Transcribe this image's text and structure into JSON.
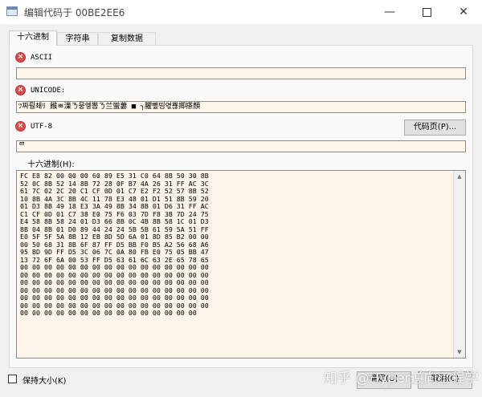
{
  "window": {
    "title": "编辑代码于 00BE2EE6",
    "minimize": "—",
    "close": "✕"
  },
  "tabs": [
    {
      "label": "十六进制"
    },
    {
      "label": "字符串"
    },
    {
      "label": "复制数据"
    }
  ],
  "ascii": {
    "label": "ASCII",
    "value": ""
  },
  "unicode": {
    "label": "UNICODE:",
    "value": "ﾂ짜뤙쵀ﾘ 餱ㅃ漅ㄋ뭉엫뽐ㄋ兰蠻蔞 ■ ┐臞뺖띵엯뾶揤搽顏"
  },
  "utf8": {
    "label": "UTF-8",
    "value": "ᄅ",
    "codepage_button": "代码页(P)..."
  },
  "hex": {
    "label": "十六进制(H):",
    "lines": [
      "FC E8 82 00 00 00 60 89 E5 31 C0 64 8B 50 30 8B",
      "52 0C 8B 52 14 8B 72 28 0F B7 4A 26 31 FF AC 3C",
      "61 7C 02 2C 20 C1 CF 0D 01 C7 E2 F2 52 57 8B 52",
      "10 8B 4A 3C 8B 4C 11 78 E3 48 01 D1 51 8B 59 20",
      "01 D3 8B 49 18 E3 3A 49 8B 34 8B 01 D6 31 FF AC",
      "C1 CF 0D 01 C7 38 E0 75 F6 03 7D F8 3B 7D 24 75",
      "E4 58 8B 58 24 01 D3 66 8B 0C 4B 8B 58 1C 01 D3",
      "8B 04 8B 01 D0 89 44 24 24 5B 5B 61 59 5A 51 FF",
      "E0 5F 5F 5A 8B 12 EB 8D 5D 6A 01 8D 85 B2 00 00",
      "00 50 68 31 8B 6F 87 FF D5 BB F0 B5 A2 56 68 A6",
      "95 BD 9D FF D5 3C 06 7C 0A 80 FB E0 75 05 BB 47",
      "13 72 6F 6A 00 53 FF D5 63 61 6C 63 2E 65 78 65",
      "00 00 00 00 00 00 00 00 00 00 00 00 00 00 00 00",
      "00 00 00 00 00 00 00 00 00 00 00 00 00 00 00 00",
      "00 00 00 00 00 00 00 00 00 00 00 00 00 00 00 00",
      "00 00 00 00 00 00 00 00 00 00 00 00 00 00 00 00",
      "00 00 00 00 00 00 00 00 00 00 00 00 00 00 00 00",
      "00 00 00 00 00 00 00 00 00 00 00 00 00 00 00 00",
      "00 00 00 00 00 00 00 00 00 00 00 00 00 00 00"
    ]
  },
  "footer": {
    "keep_size_label": "保持大小(K)",
    "keep_size_checked": false,
    "ok_button": "确定(O)",
    "cancel_button": "取消(C)",
    "watermark": "知乎 @Hyper逆向工程学"
  },
  "icons": {
    "error": "error-icon",
    "app": "window-icon"
  }
}
